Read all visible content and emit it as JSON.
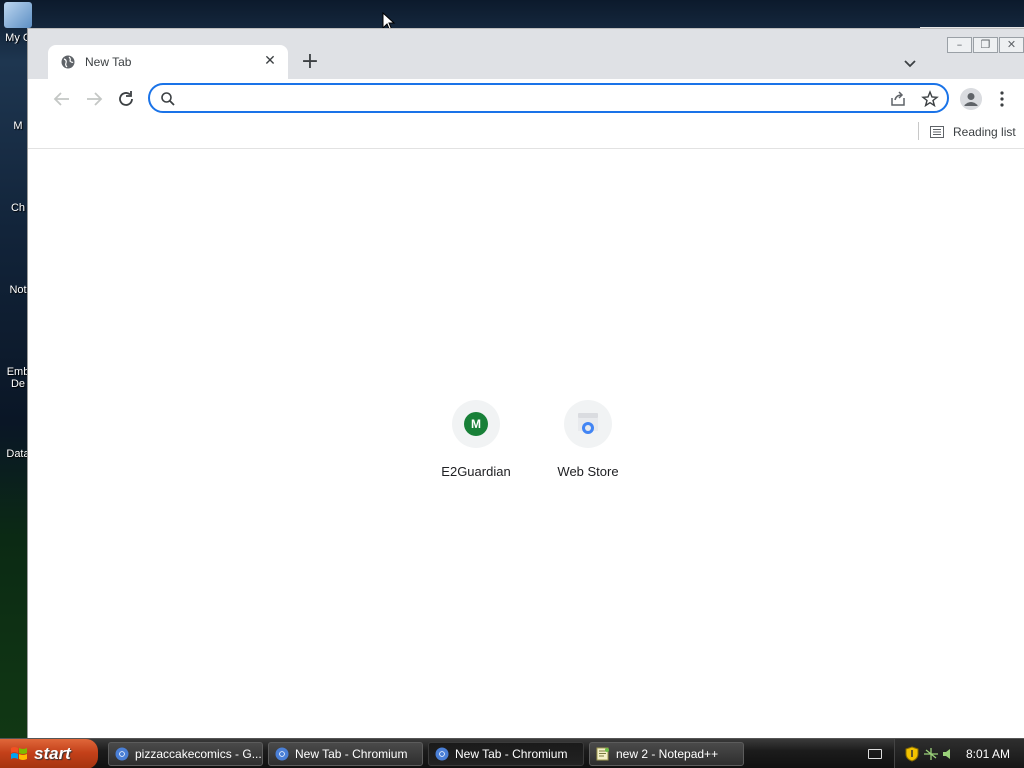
{
  "desktop": {
    "icons": [
      {
        "label": "My C"
      },
      {
        "label": "M"
      },
      {
        "label": "Ch"
      },
      {
        "label": "Not"
      },
      {
        "label": "Emb"
      },
      {
        "label": "De"
      },
      {
        "label": "Data"
      }
    ]
  },
  "browser": {
    "tab": {
      "title": "New Tab",
      "close_symbol": "✕"
    },
    "new_tab_symbol": "+",
    "window_controls": {
      "minimize": "–",
      "restore": "❐",
      "close": "✕"
    },
    "omnibox": {
      "value": "",
      "placeholder": ""
    },
    "bookmarks": {
      "reading_list_label": "Reading list"
    },
    "shortcuts": [
      {
        "label": "E2Guardian",
        "badge": "M"
      },
      {
        "label": "Web Store"
      }
    ]
  },
  "taskbar": {
    "start_label": "start",
    "items": [
      {
        "label": "pizzaccakecomics - G..."
      },
      {
        "label": "New Tab - Chromium"
      },
      {
        "label": "New Tab - Chromium"
      },
      {
        "label": "new 2 - Notepad++"
      }
    ],
    "clock": "8:01 AM"
  },
  "colors": {
    "accent": "#1a73e8",
    "badge_green": "#188038",
    "start_orange": "#c4411a"
  }
}
